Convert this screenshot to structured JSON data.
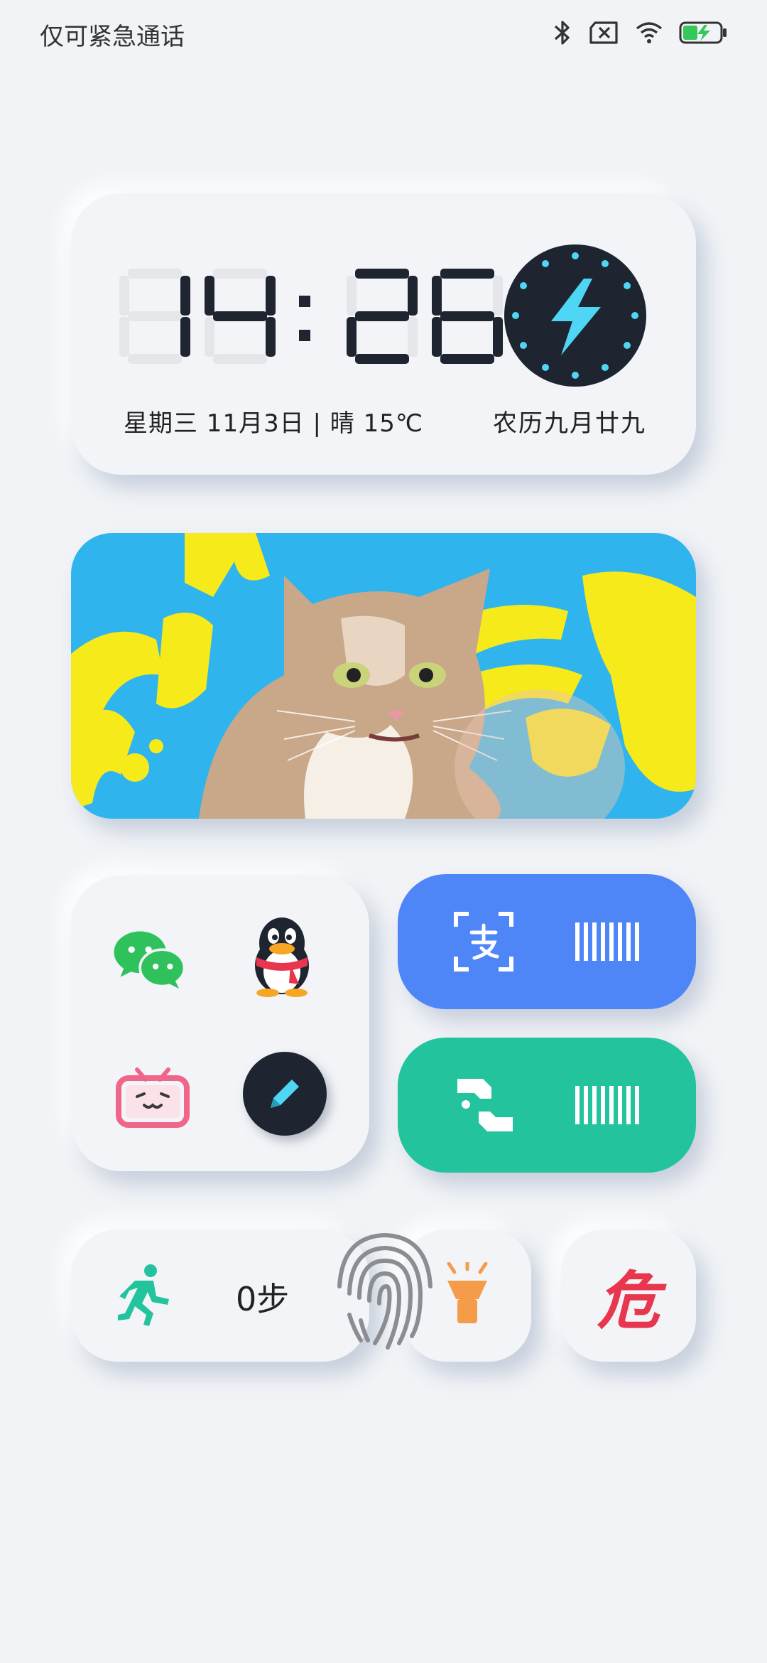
{
  "status": {
    "carrier_text": "仅可紧急通话",
    "icons": [
      "bluetooth-icon",
      "no-sim-icon",
      "wifi-icon",
      "battery-charging-icon"
    ]
  },
  "clock": {
    "time": "14:26",
    "date_weather": "星期三 11月3日 | 晴 15℃",
    "lunar_date": "农历九月廿九",
    "dial_icon": "lightning-icon"
  },
  "banner": {
    "image": "cat-poster"
  },
  "apps": [
    {
      "name": "wechat-icon"
    },
    {
      "name": "qq-icon"
    },
    {
      "name": "bilibili-icon"
    },
    {
      "name": "pen-icon"
    }
  ],
  "pay": {
    "alipay": {
      "scan_icon": "alipay-scan-icon",
      "code_icon": "barcode-icon",
      "color": "#4e86f7"
    },
    "wechat_pay": {
      "scan_icon": "wechat-pay-icon",
      "code_icon": "barcode-icon",
      "color": "#22c39d"
    }
  },
  "steps": {
    "count_label": "0步"
  },
  "torch": {
    "icon": "flashlight-icon"
  },
  "danger": {
    "char": "危"
  },
  "colors": {
    "background": "#f1f3f6",
    "accent_cyan": "#4fd6f5",
    "danger_red": "#e8364e"
  }
}
